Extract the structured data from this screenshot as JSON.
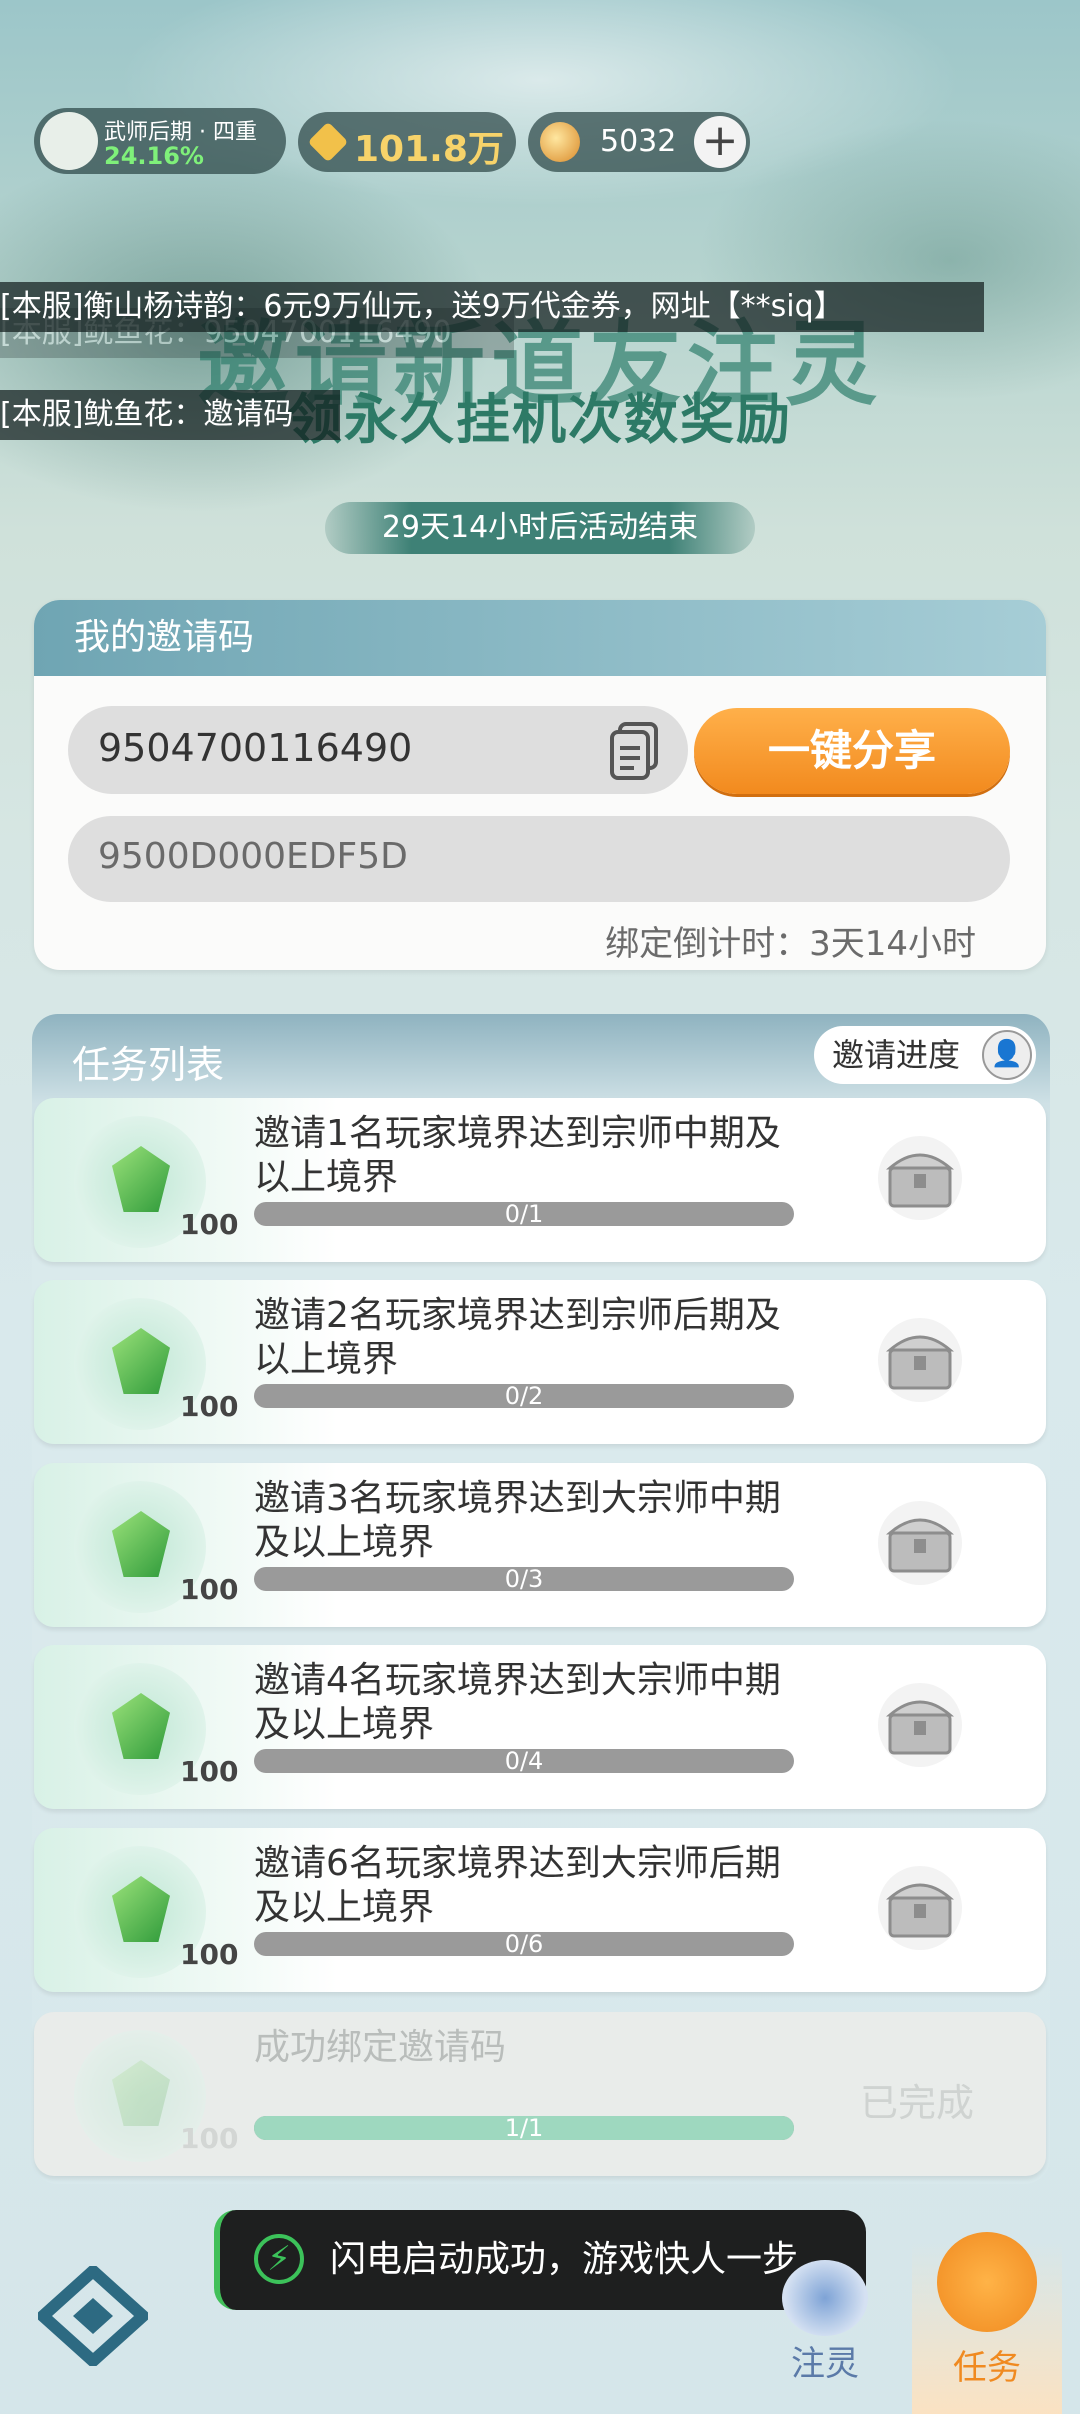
{
  "status": {
    "realm_name": "武师后期 · 四重",
    "realm_percent": "24.16%",
    "power": "101.8万",
    "coins": "5032",
    "plus": "+"
  },
  "event": {
    "headline": "邀请新道友注灵",
    "subtitle": "领永久挂机次数奖励",
    "countdown": "29天14小时后活动结束"
  },
  "chat": [
    "[本服]衡山杨诗韵：6元9万仙元，送9万代金券，网址【**siq】",
    "[本服]鱿鱼花：9504700116490",
    "[本服]鱿鱼花：邀请码"
  ],
  "invite": {
    "title": "我的邀请码",
    "code": "9504700116490",
    "share_label": "一键分享",
    "input_placeholder": "9500D000EDF5D",
    "bind_countdown": "绑定倒计时：3天14小时"
  },
  "tasks_panel": {
    "title": "任务列表",
    "progress_button": "邀请进度"
  },
  "tasks": [
    {
      "desc": "邀请1名玩家境界达到宗师中期及以上境界",
      "qty": "100",
      "progress": "0/1",
      "fraction": 0
    },
    {
      "desc": "邀请2名玩家境界达到宗师后期及以上境界",
      "qty": "100",
      "progress": "0/2",
      "fraction": 0
    },
    {
      "desc": "邀请3名玩家境界达到大宗师中期及以上境界",
      "qty": "100",
      "progress": "0/3",
      "fraction": 0
    },
    {
      "desc": "邀请4名玩家境界达到大宗师中期及以上境界",
      "qty": "100",
      "progress": "0/4",
      "fraction": 0
    },
    {
      "desc": "邀请6名玩家境界达到大宗师后期及以上境界",
      "qty": "100",
      "progress": "0/6",
      "fraction": 0
    },
    {
      "desc": "成功绑定邀请码",
      "qty": "100",
      "progress": "1/1",
      "fraction": 1,
      "status": "已完成"
    }
  ],
  "toast": "闪电启动成功，游戏快人一步",
  "nav": {
    "inject": "注灵",
    "task": "任务"
  },
  "colors": {
    "accent_orange": "#f28a1e",
    "done_bar": "#9ed8bf",
    "realm_green": "#7ff07a"
  }
}
